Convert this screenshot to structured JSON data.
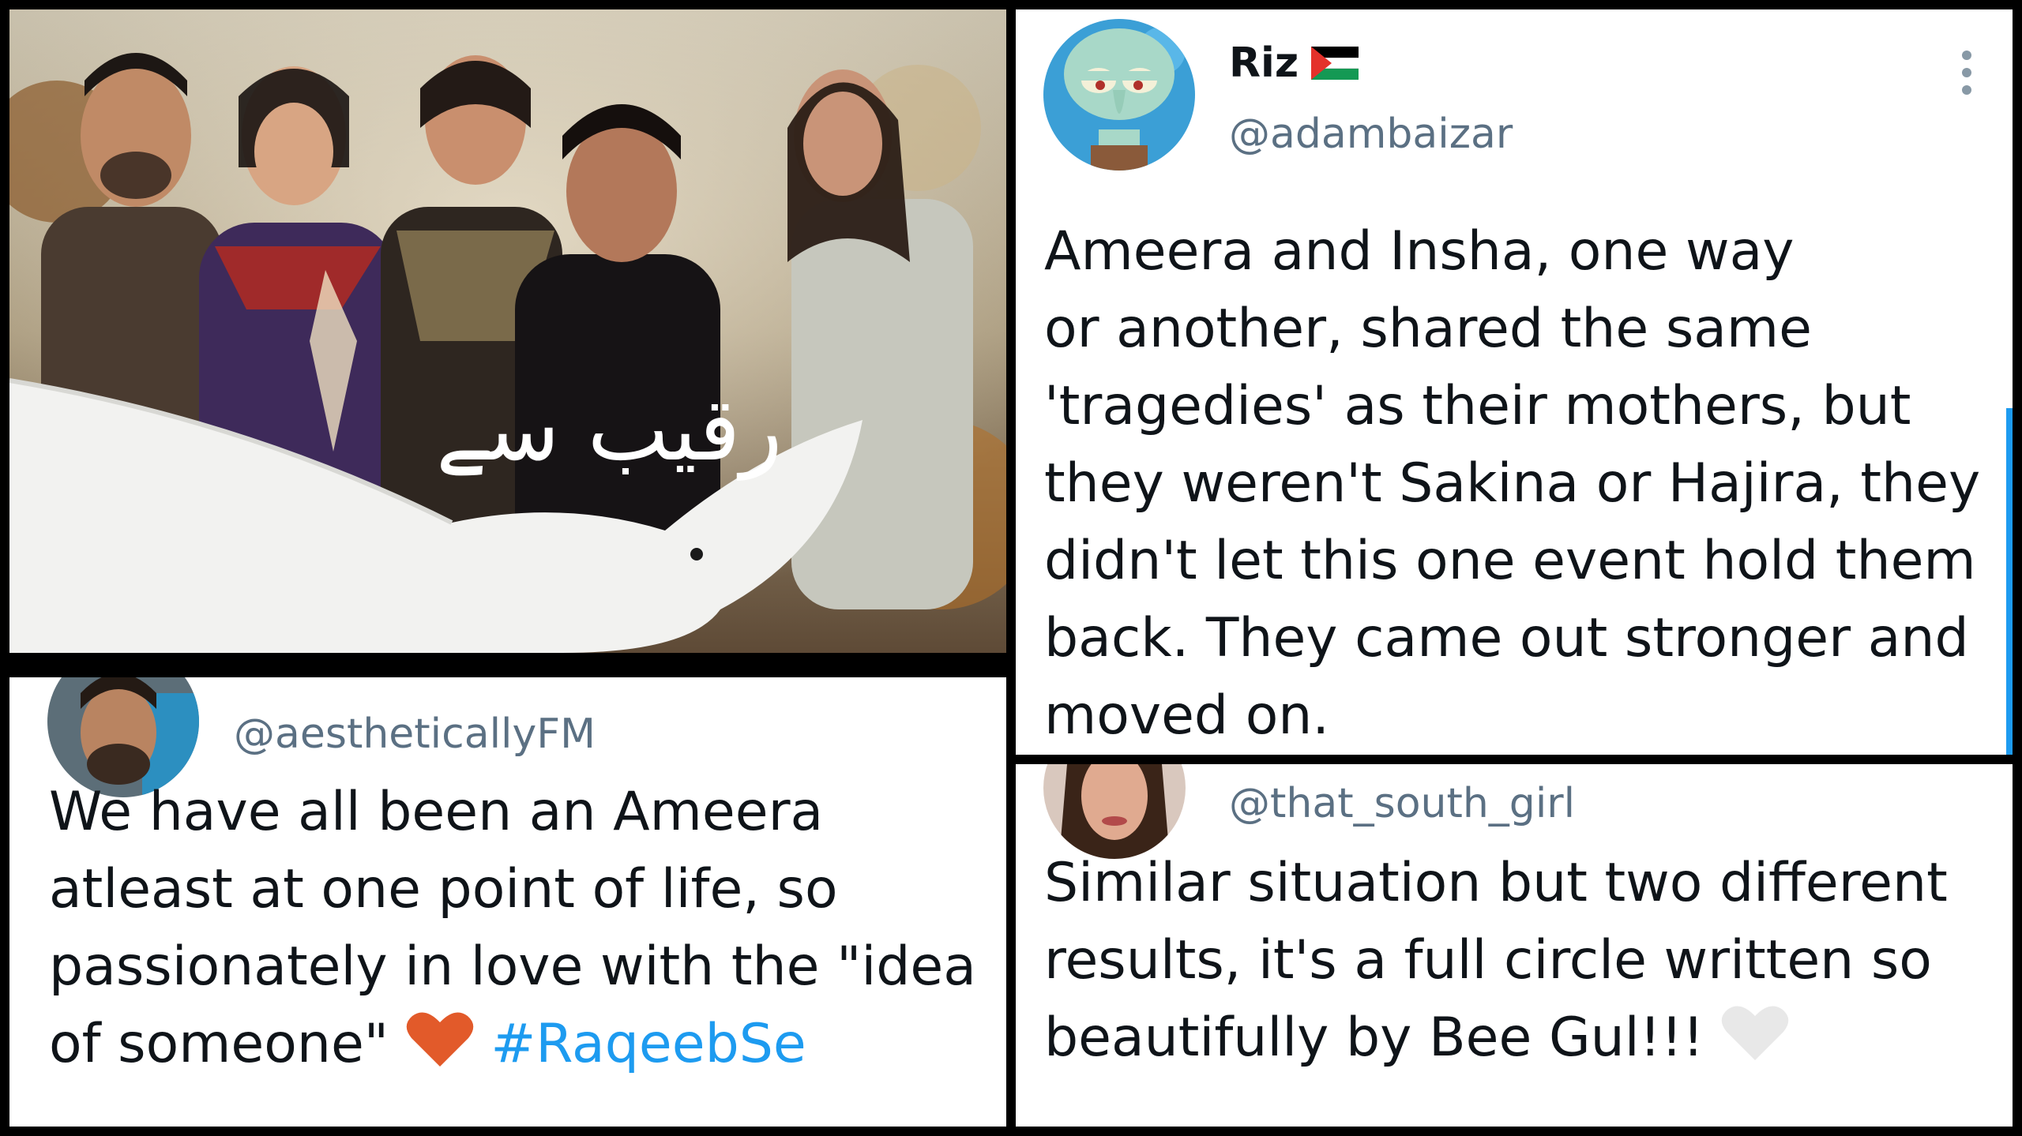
{
  "poster": {
    "title_urdu": "رقیب سے"
  },
  "tweet_riz": {
    "display_name": "Riz",
    "flag_icon": "palestine-flag-icon",
    "handle": "@adambaizar",
    "text": "Ameera and Insha, one way\nor another, shared the same\n'tragedies' as their mothers, but\nthey weren't Sakina or Hajira, they\ndidn't let this one event hold them\nback. They came out stronger and\nmoved on."
  },
  "tweet_fm": {
    "handle": "@aestheticallyFM",
    "text": "We have all been an Ameera\natleast at one point of life, so\npassionately in love with the \"idea\nof someone\" ",
    "emoji": "orange-heart-icon",
    "hashtag": "#RaqeebSe"
  },
  "tweet_girl": {
    "handle": "@that_south_girl",
    "text": "Similar situation but two different\nresults, it's a full circle written so\nbeautifully by Bee Gul!!! ",
    "emoji": "white-heart-icon"
  },
  "colors": {
    "text": "#0f1419",
    "handle": "#5b7083",
    "hashtag": "#1d9bf0",
    "orange_heart": "#e25a2a",
    "white_heart": "#e8e8e8",
    "border": "#000000"
  }
}
